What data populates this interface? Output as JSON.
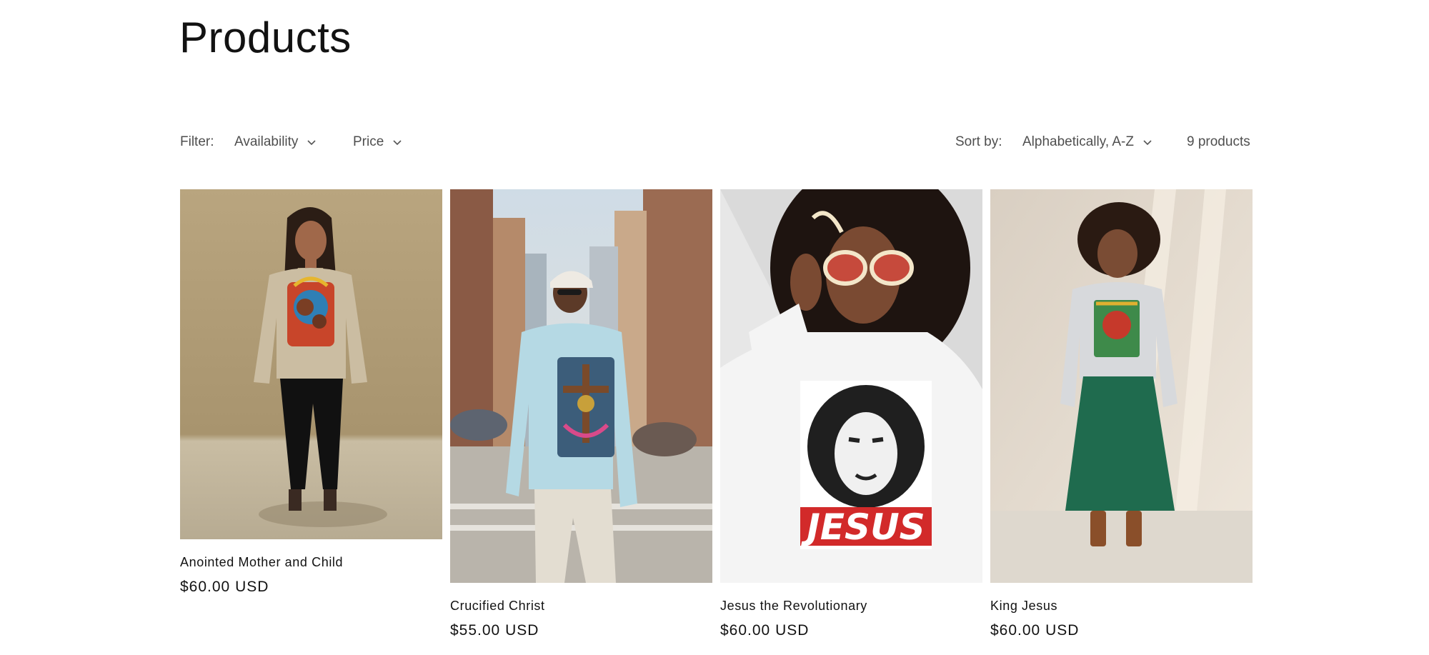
{
  "page": {
    "title": "Products"
  },
  "filters": {
    "label": "Filter:",
    "availability": "Availability",
    "price": "Price"
  },
  "sort": {
    "label": "Sort by:",
    "value": "Alphabetically, A-Z"
  },
  "product_count": "9 products",
  "products": [
    {
      "title": "Anointed Mother and Child",
      "price": "$60.00 USD",
      "image_alt": "model in beige sweatshirt with mother and child print"
    },
    {
      "title": "Crucified Christ",
      "price": "$55.00 USD",
      "image_alt": "man in light blue sweatshirt with crucifixion print on city street"
    },
    {
      "title": "Jesus the Revolutionary",
      "price": "$60.00 USD",
      "image_alt": "woman in white sweatshirt with black and red JESUS print",
      "print_text": "JESUS"
    },
    {
      "title": "King Jesus",
      "price": "$60.00 USD",
      "image_alt": "woman in grey sweatshirt and green skirt"
    }
  ],
  "colors": {
    "text": "#121212",
    "muted": "#5a5a5a",
    "jesus_red": "#d22a2a"
  }
}
